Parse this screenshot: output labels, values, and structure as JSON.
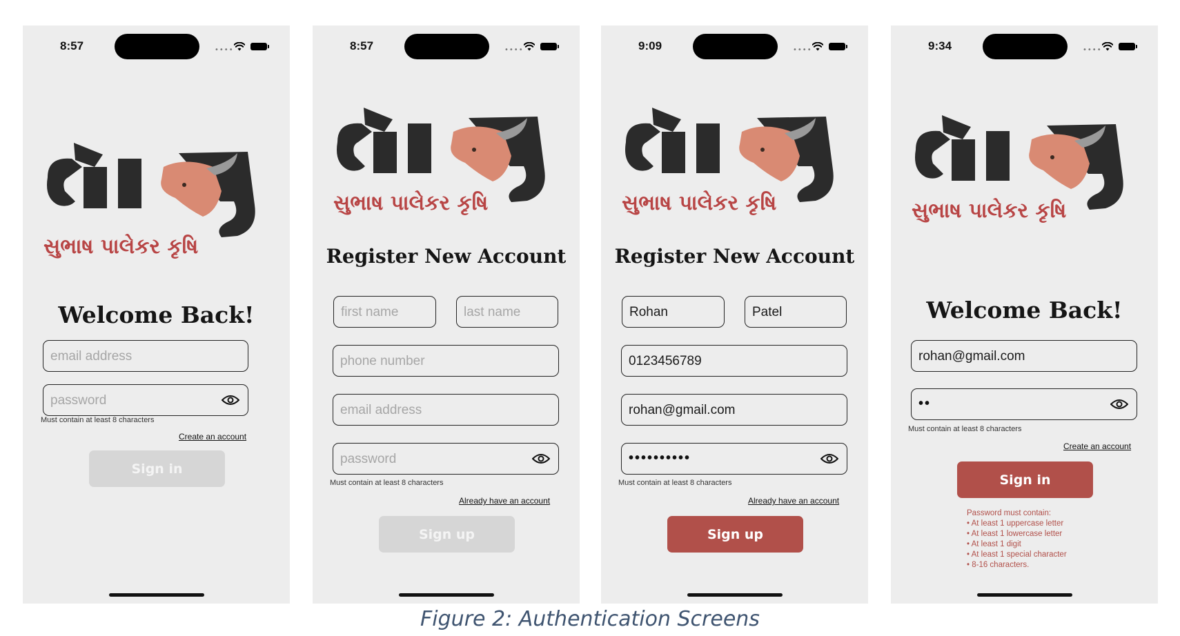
{
  "screens": [
    {
      "time": "8:57",
      "logo_subtitle": "સુભાષ પાલેકર કૃષિ",
      "heading": "Welcome Back!",
      "email_placeholder": "email address",
      "password_placeholder": "password",
      "hint": "Must contain at least 8 characters",
      "link": "Create an account",
      "button": "Sign in",
      "button_state": "disabled"
    },
    {
      "time": "8:57",
      "logo_subtitle": "સુભાષ પાલેકર કૃષિ",
      "heading": "Register New Account",
      "first_name_placeholder": "first name",
      "last_name_placeholder": "last name",
      "phone_placeholder": "phone number",
      "email_placeholder": "email address",
      "password_placeholder": "password",
      "hint": "Must contain at least 8 characters",
      "link": "Already have an account",
      "button": "Sign up",
      "button_state": "disabled"
    },
    {
      "time": "9:09",
      "logo_subtitle": "સુભાષ પાલેકર કૃષિ",
      "heading": "Register New Account",
      "first_name": "Rohan",
      "last_name": "Patel",
      "phone": "0123456789",
      "email": "rohan@gmail.com",
      "password_mask": "••••••••••",
      "hint": "Must contain at least 8 characters",
      "link": "Already have an account",
      "button": "Sign up",
      "button_state": "enabled"
    },
    {
      "time": "9:34",
      "logo_subtitle": "સુભાષ પાલેકર કૃષિ",
      "heading": "Welcome Back!",
      "email": "rohan@gmail.com",
      "password_mask": "••",
      "hint": "Must contain at least 8 characters",
      "link": "Create an account",
      "button": "Sign in",
      "button_state": "enabled",
      "password_rules_title": "Password must contain:",
      "password_rules": [
        "• At least 1 uppercase letter",
        "• At least 1 lowercase letter",
        "• At least 1 digit",
        "• At least 1 special character",
        "• 8-16 characters."
      ]
    }
  ],
  "caption": "Figure 2: Authentication Screens",
  "colors": {
    "accent": "#b1504a",
    "disabled_button": "#d6d6d6",
    "screen_bg": "#ededed",
    "caption": "#3f5470"
  },
  "icons": [
    "wifi-icon",
    "battery-icon",
    "eye-icon",
    "cow-logo"
  ]
}
